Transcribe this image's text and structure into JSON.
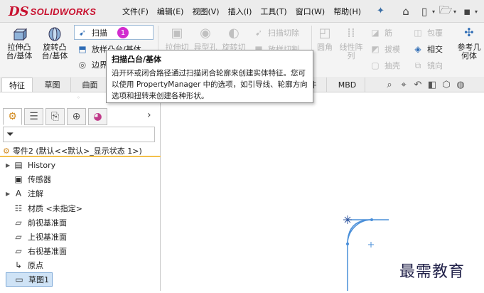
{
  "app": {
    "logo_ds": "DS",
    "logo_text": "SOLIDWORKS"
  },
  "menu": [
    "文件(F)",
    "编辑(E)",
    "视图(V)",
    "插入(I)",
    "工具(T)",
    "窗口(W)",
    "帮助(H)"
  ],
  "ribbon": {
    "extrude_boss": "拉伸凸\n台/基体",
    "revolve_boss": "旋转凸\n台/基体",
    "sweep": "扫描",
    "sweep_badge": "1",
    "loft": "放样凸台/基体",
    "boundary": "边界",
    "extrude_cut": "拉伸切",
    "hole_wizard": "异型孔",
    "revolve_cut": "旋转切",
    "sweep_cut": "扫描切除",
    "loft_cut": "放样切割",
    "fillet": "圆角",
    "linear_pattern": "线性阵\n列",
    "rib": "筋",
    "wrap": "包覆",
    "draft": "拔模",
    "intersect": "相交",
    "shell": "抽壳",
    "mirror": "镜向",
    "reference_geometry": "参考几\n何体"
  },
  "tabs": [
    "特征",
    "草图",
    "曲面",
    "插件",
    "MBD"
  ],
  "active_tab": 0,
  "tooltip": {
    "title": "扫描凸台/基体",
    "body": "沿开环或闭合路径通过扫描闭合轮廓来创建实体特征。您可以使用 PropertyManager 中的选项，如引导线、轮廓方向选项和扭转来创建各种形状。"
  },
  "feature_tree": {
    "root": "零件2 (默认<<默认>_显示状态 1>)",
    "items": [
      {
        "label": "History",
        "icon": "history-icon",
        "expandable": true
      },
      {
        "label": "传感器",
        "icon": "sensor-icon",
        "expandable": false
      },
      {
        "label": "注解",
        "icon": "annotation-icon",
        "expandable": true
      },
      {
        "label": "材质 <未指定>",
        "icon": "material-icon",
        "expandable": false
      },
      {
        "label": "前视基准面",
        "icon": "plane-icon",
        "expandable": false
      },
      {
        "label": "上视基准面",
        "icon": "plane-icon",
        "expandable": false
      },
      {
        "label": "右视基准面",
        "icon": "plane-icon",
        "expandable": false
      },
      {
        "label": "原点",
        "icon": "origin-icon",
        "expandable": false
      },
      {
        "label": "草图1",
        "icon": "sketch-icon",
        "expandable": false,
        "selected": true
      }
    ]
  },
  "watermark": "最需教育",
  "colors": {
    "accent": "#c8102e",
    "badge": "#d22ccf",
    "sketch": "#4a8fd9",
    "tree_underline": "#f3c04a"
  }
}
